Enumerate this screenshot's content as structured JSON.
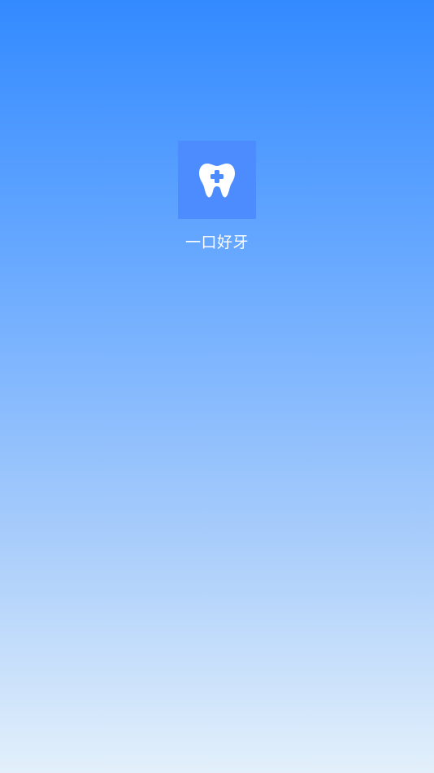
{
  "app": {
    "name": "一口好牙",
    "logo_icon": "tooth-plus-icon"
  },
  "colors": {
    "gradient_top": "#338aff",
    "gradient_bottom": "#e3f0fb",
    "logo_background": "#4d8cff",
    "logo_foreground": "#ffffff",
    "text": "#ffffff"
  }
}
